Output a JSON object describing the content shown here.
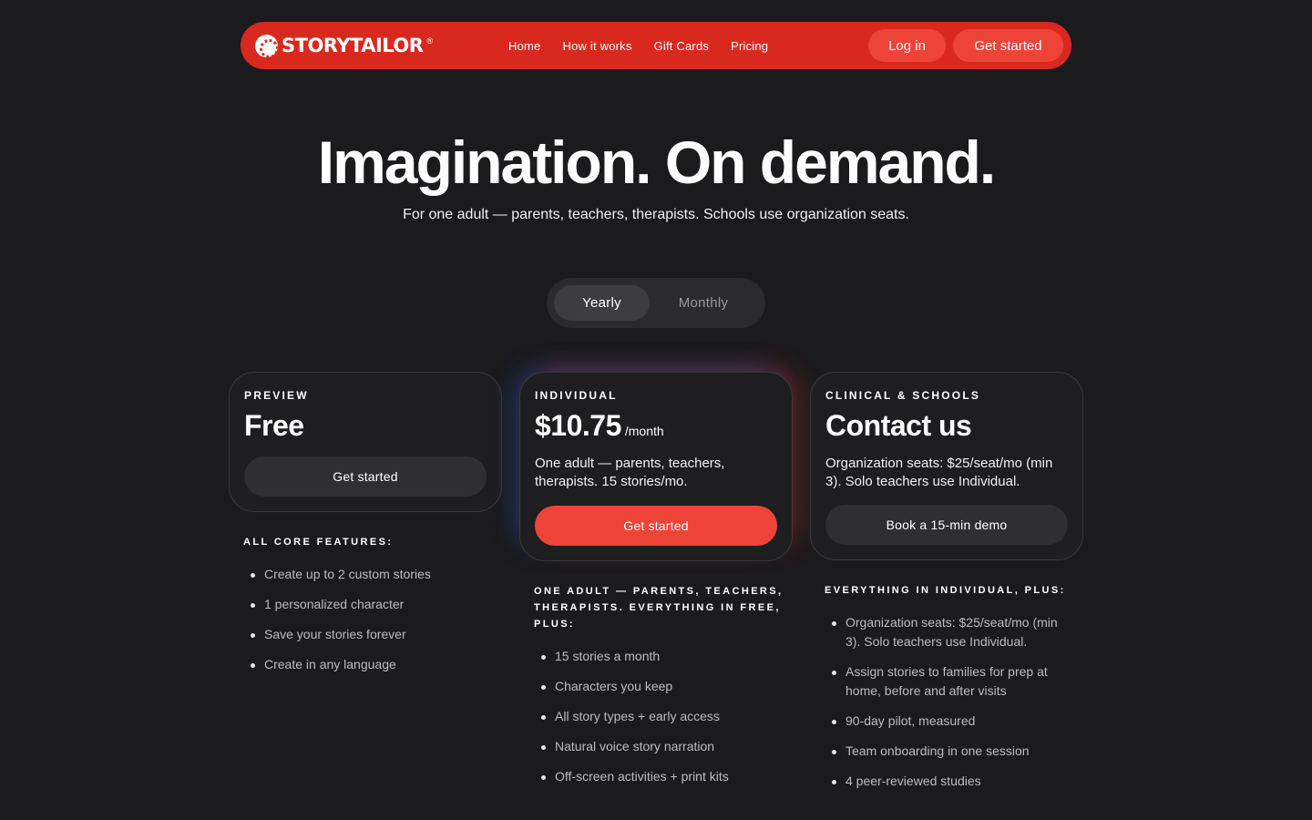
{
  "nav": {
    "logo_text": "STORYTAILOR",
    "logo_reg": "®",
    "links": [
      "Home",
      "How it works",
      "Gift Cards",
      "Pricing"
    ],
    "login_label": "Log in",
    "start_label": "Get started"
  },
  "hero": {
    "title": "Imagination. On demand.",
    "subtitle": "For one adult — parents, teachers, therapists. Schools use organization seats."
  },
  "billing_toggle": {
    "options": [
      "Yearly",
      "Monthly"
    ],
    "selected": "Yearly"
  },
  "plans": [
    {
      "label": "PREVIEW",
      "price": "Free",
      "per": "",
      "description": "",
      "cta": "Get started",
      "features_heading": "ALL CORE FEATURES:",
      "features": [
        "Create up to 2 custom stories",
        "1 personalized character",
        "Save your stories forever",
        "Create in any language"
      ]
    },
    {
      "label": "INDIVIDUAL",
      "price": "$10.75",
      "per": "/month",
      "description": "One adult — parents, teachers, therapists. 15 stories/mo.",
      "cta": "Get started",
      "features_heading": "ONE ADULT — PARENTS, TEACHERS, THERAPISTS. EVERYTHING IN FREE, PLUS:",
      "features": [
        "15 stories a month",
        "Characters you keep",
        "All story types + early access",
        "Natural voice story narration",
        "Off-screen activities + print kits"
      ]
    },
    {
      "label": "CLINICAL & SCHOOLS",
      "price": "Contact us",
      "per": "",
      "description": "Organization seats: $25/seat/mo (min 3). Solo teachers use Individual.",
      "cta": "Book a 15-min demo",
      "features_heading": "EVERYTHING IN INDIVIDUAL, PLUS:",
      "features": [
        "Organization seats: $25/seat/mo (min 3). Solo teachers use Individual.",
        "Assign stories to families for prep at home, before and after visits",
        "90-day pilot, measured",
        "Team onboarding in one session",
        "4 peer-reviewed studies"
      ]
    }
  ],
  "colors": {
    "background": "#1b1a1c",
    "brand_red": "#d9291f",
    "accent_red": "#ee4337",
    "card_border": "#3a393c"
  }
}
